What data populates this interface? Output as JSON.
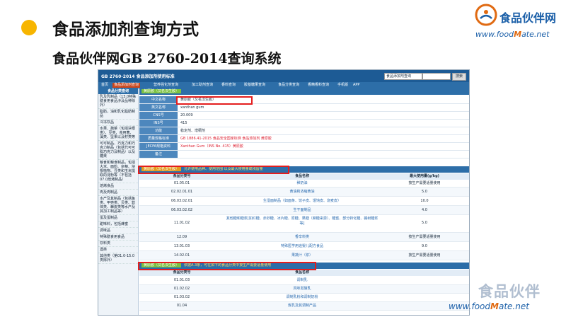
{
  "slide": {
    "title": "食品添加剂查询方式",
    "subtitle": "食品伙伴网GB 2760-2014查询系统"
  },
  "logo": {
    "name": "食品伙伴网",
    "url_prefix": "www.food",
    "url_m": "M",
    "url_suffix": "ate.net"
  },
  "system": {
    "title": "GB 2760-2014 食品添加剂使用标准",
    "search_select": "食品添加剂查询",
    "search_button": "搜索",
    "nav": [
      "首页",
      "食品添加剂查询",
      "营养强化剂查询",
      "加工助剂查询",
      "香料查询",
      "胶基糖果查询",
      "食品分类查询",
      "香精香料查询",
      "手机版",
      "APP"
    ]
  },
  "sidebar": {
    "header": "食品分类查询",
    "items": [
      "乳及乳制品（13.0特殊膳食用食品涉及品种除外）",
      "脂肪，油和乳化脂肪制品",
      "冷冻饮品",
      "水果、蔬菜（包括块根类）、豆类、食用菌、藻类、坚果以及籽类等",
      "可可制品、巧克力和巧克力制品（包括代可可脂巧克力及制品）以及糖果",
      "粮食和粮食制品，包括大米、面粉、杂粮、块根植物、豆类和玉米提取的淀粉等（不包括07.0焙烤制品）",
      "焙烤食品",
      "肉及肉制品",
      "水产及其制品（包括鱼类、甲壳类、贝类、软体类、棘皮类等水产及其加工制品等）",
      "蛋及蛋制品",
      "甜味料，包括蜂蜜",
      "调味品",
      "特殊膳食用食品",
      "饮料类",
      "酒类",
      "其他类（第01.0-15.0类除外）"
    ]
  },
  "section1": {
    "tag": "黄原胶（又名汉生胶）"
  },
  "info": [
    {
      "label": "中文名称",
      "value": "黄原胶（又名汉生胶）"
    },
    {
      "label": "英文名称",
      "value": "xanthan gum"
    },
    {
      "label": "CNS号",
      "value": "20.009"
    },
    {
      "label": "INS号",
      "value": "415"
    },
    {
      "label": "功能",
      "value": "稳定剂、增稠剂"
    },
    {
      "label": "质量规格标准",
      "value": "GB 1886.41-2015 食品安全国家标准 食品添加剂 黄原胶"
    },
    {
      "label": "JECFA规格资料",
      "value": "Xanthan Gum（INS No. 415）黄原胶"
    },
    {
      "label": "备注",
      "value": ""
    }
  ],
  "section2": {
    "tag": "黄原胶（又名汉生胶）",
    "note": "允许使用品种、使用范围 以及最大使用量或残留量"
  },
  "table_headers": [
    "食品分类号",
    "食品名称",
    "最大使用量(g/kg)"
  ],
  "rows1": [
    [
      "01.05.01",
      "稀奶油",
      "按生产需要适量使用"
    ],
    [
      "02.02.01.01",
      "黄油和浓缩黄油",
      "5.0"
    ],
    [
      "06.03.02.01",
      "生湿面制品（如面条、饺子皮、馄饨皮、烧麦皮）",
      "10.0"
    ],
    [
      "06.03.02.02",
      "生干面制品",
      "4.0"
    ],
    [
      "11.01.02",
      "其他糖和糖浆[如红糖、赤砂糖、冰片糖、原糖、果糖（蔗糖来源）、糖蜜、部分转化糖、槭树糖浆等]",
      "5.0"
    ],
    [
      "12.09",
      "香辛料类",
      "按生产需要适量使用"
    ],
    [
      "13.01.03",
      "特殊医学用途婴儿配方食品",
      "9.0"
    ],
    [
      "14.02.01",
      "果蔬汁（浆）",
      "按生产需要适量使用"
    ]
  ],
  "section3": {
    "tag": "黄原胶（又名汉生胶）",
    "note": "依据A.3条，可在如下的食品分类中按生产需要适量使用"
  },
  "rows2": [
    [
      "01.01.03",
      "调制乳"
    ],
    [
      "01.02.02",
      "风味发酵乳"
    ],
    [
      "01.03.02",
      "调制乳粉和调制奶粉"
    ],
    [
      "01.04",
      "炼乳及其调制产品"
    ]
  ],
  "watermark": {
    "mark": "食品伙伴",
    "url_prefix": "www.food",
    "url_m": "M",
    "url_suffix": "ate.net"
  },
  "colors": {
    "accent": "#f7b500",
    "header_blue": "#1d5b95",
    "highlight_red": "#e41e1e"
  }
}
